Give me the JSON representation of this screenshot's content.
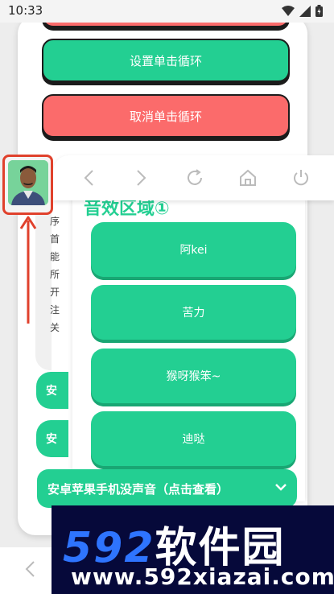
{
  "status": {
    "time": "10:33"
  },
  "back_card": {
    "buttons": {
      "set_loop": "设置单击循环",
      "cancel_loop": "取消单击循环"
    },
    "side_pill_char": "安",
    "text_column": [
      "序",
      "首",
      "能",
      "所",
      "开",
      "注",
      "关"
    ]
  },
  "front_card": {
    "nav": {
      "back_icon": "chevron-left-icon",
      "forward_icon": "chevron-right-icon",
      "refresh_icon": "refresh-icon",
      "home_icon": "home-icon",
      "power_icon": "power-icon"
    },
    "panel_heading": "音效区域①",
    "sounds": [
      "阿kei",
      "苦力",
      "猴呀猴笨~",
      "迪哒"
    ]
  },
  "banner": {
    "label": "安卓苹果手机没声音（点击查看）"
  },
  "watermark": {
    "brand_num": "592",
    "brand_cn": "软件园",
    "url": "www.592xiazai.com"
  },
  "colors": {
    "green": "#23cf92",
    "red": "#fb6b6b",
    "watermark_bg": "#06093a",
    "watermark_blue": "#2e74ff"
  }
}
